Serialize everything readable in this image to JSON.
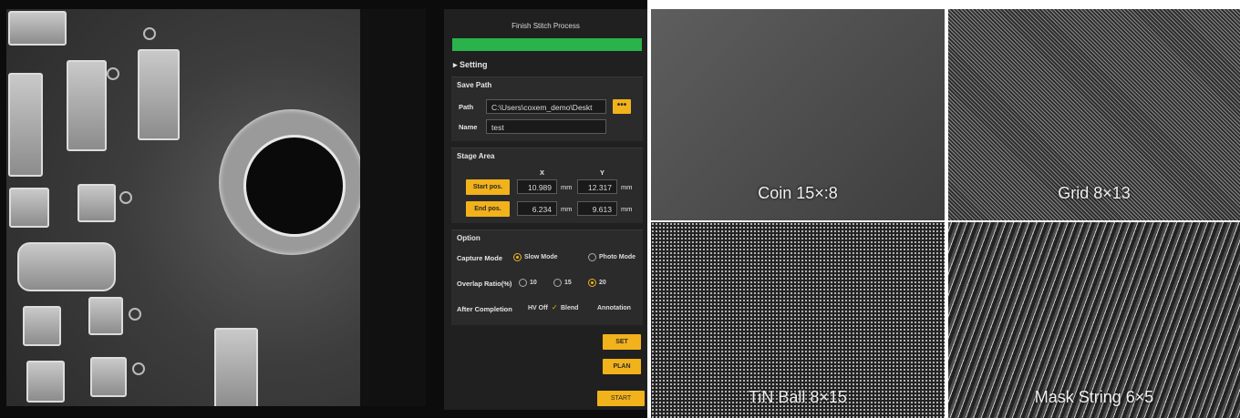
{
  "app": {
    "process_title": "Finish Stitch Process",
    "progress": 1.0,
    "accent_color": "#f2b21b",
    "progress_color": "#2ab34a"
  },
  "setting": {
    "header": "▸ Setting",
    "save_path": {
      "title": "Save Path",
      "path_label": "Path",
      "path_value": "C:\\Users\\coxem_demo\\Deskt",
      "browse_label": "•••",
      "name_label": "Name",
      "name_value": "test"
    },
    "stage_area": {
      "title": "Stage Area",
      "col_x": "X",
      "col_y": "Y",
      "start_label": "Start pos.",
      "start_x": "10.989",
      "start_y": "12.317",
      "end_label": "End pos.",
      "end_x": "6.234",
      "end_y": "9.613",
      "unit": "mm"
    },
    "option": {
      "title": "Option",
      "capture_label": "Capture Mode",
      "capture_opts": [
        "Slow Mode",
        "Photo Mode"
      ],
      "capture_selected": "Slow Mode",
      "overlap_label": "Overlap Ratio(%)",
      "overlap_opts": [
        "10",
        "15",
        "20"
      ],
      "overlap_selected": "20",
      "after_label": "After Completion",
      "after_opts": [
        "HV Off",
        "Blend",
        "Annotation"
      ],
      "after_checked": "Blend"
    },
    "buttons": {
      "set": "SET",
      "plan": "PLAN",
      "start": "START"
    }
  },
  "samples": [
    {
      "label": "Coin 15×:8"
    },
    {
      "label": "Grid 8×13"
    },
    {
      "label": "TiN Ball 8×15"
    },
    {
      "label": "Mask String 6×5"
    }
  ]
}
